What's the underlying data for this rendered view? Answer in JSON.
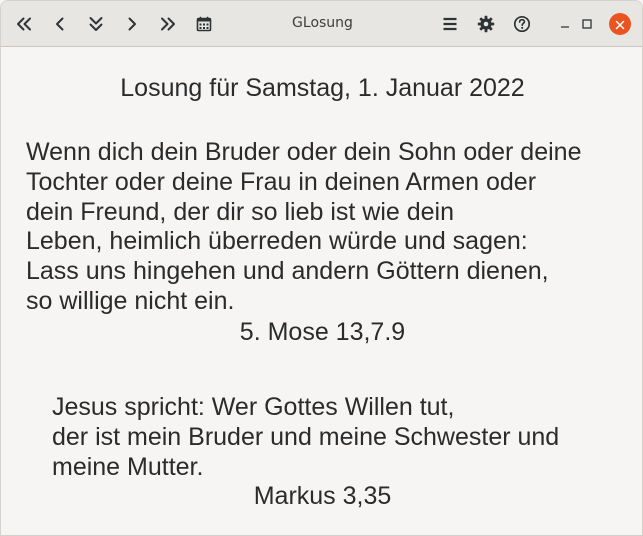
{
  "window": {
    "title": "GLosung"
  },
  "toolbar": {
    "buttons": [
      {
        "icon": "double-chevron-left-icon"
      },
      {
        "icon": "chevron-left-icon"
      },
      {
        "icon": "double-chevron-down-icon"
      },
      {
        "icon": "chevron-right-icon"
      },
      {
        "icon": "double-chevron-right-icon"
      },
      {
        "icon": "calendar-icon"
      }
    ],
    "right_buttons": [
      {
        "icon": "hamburger-menu-icon"
      },
      {
        "icon": "gear-icon"
      },
      {
        "icon": "help-icon"
      }
    ],
    "window_controls": [
      {
        "icon": "minimize-icon"
      },
      {
        "icon": "maximize-icon"
      },
      {
        "icon": "close-icon",
        "color": "#e95420"
      }
    ]
  },
  "losung": {
    "heading": "Losung für Samstag,  1. Januar 2022",
    "verse_lines": [
      "Wenn dich dein Bruder oder dein Sohn oder deine",
      "Tochter oder deine Frau in deinen Armen oder",
      "dein Freund, der dir so lieb ist wie dein",
      "Leben, heimlich überreden würde und sagen:",
      "Lass uns hingehen und andern Göttern dienen,",
      "so willige nicht ein."
    ],
    "reference": "5. Mose 13,7.9"
  },
  "lehrtext": {
    "verse_lines": [
      "Jesus spricht: Wer Gottes Willen tut,",
      "der ist mein Bruder und meine Schwester und",
      "meine Mutter."
    ],
    "reference": "Markus 3,35"
  }
}
